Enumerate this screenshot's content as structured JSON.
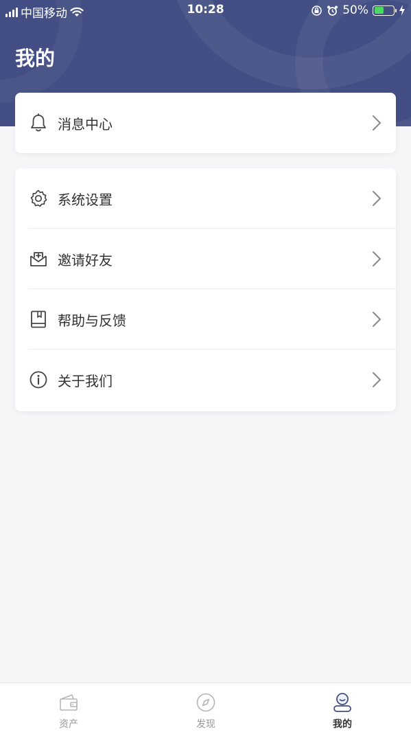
{
  "status_bar": {
    "carrier": "中国移动",
    "time": "10:28",
    "battery": "50%",
    "battery_level": 0.5
  },
  "header": {
    "title": "我的"
  },
  "message_card": {
    "label": "消息中心",
    "icon": "bell-icon"
  },
  "menu": {
    "items": [
      {
        "label": "系统设置",
        "icon": "gear-icon"
      },
      {
        "label": "邀请好友",
        "icon": "invite-icon"
      },
      {
        "label": "帮助与反馈",
        "icon": "book-icon"
      },
      {
        "label": "关于我们",
        "icon": "info-icon"
      }
    ]
  },
  "tabbar": {
    "tabs": [
      {
        "label": "资产",
        "icon": "wallet-icon",
        "active": false
      },
      {
        "label": "发现",
        "icon": "compass-icon",
        "active": false
      },
      {
        "label": "我的",
        "icon": "profile-icon",
        "active": true
      }
    ]
  },
  "colors": {
    "header_bg": "#434f84",
    "page_bg": "#f6f6f8",
    "battery_green": "#4cd964",
    "active_tab": "#434f84"
  }
}
